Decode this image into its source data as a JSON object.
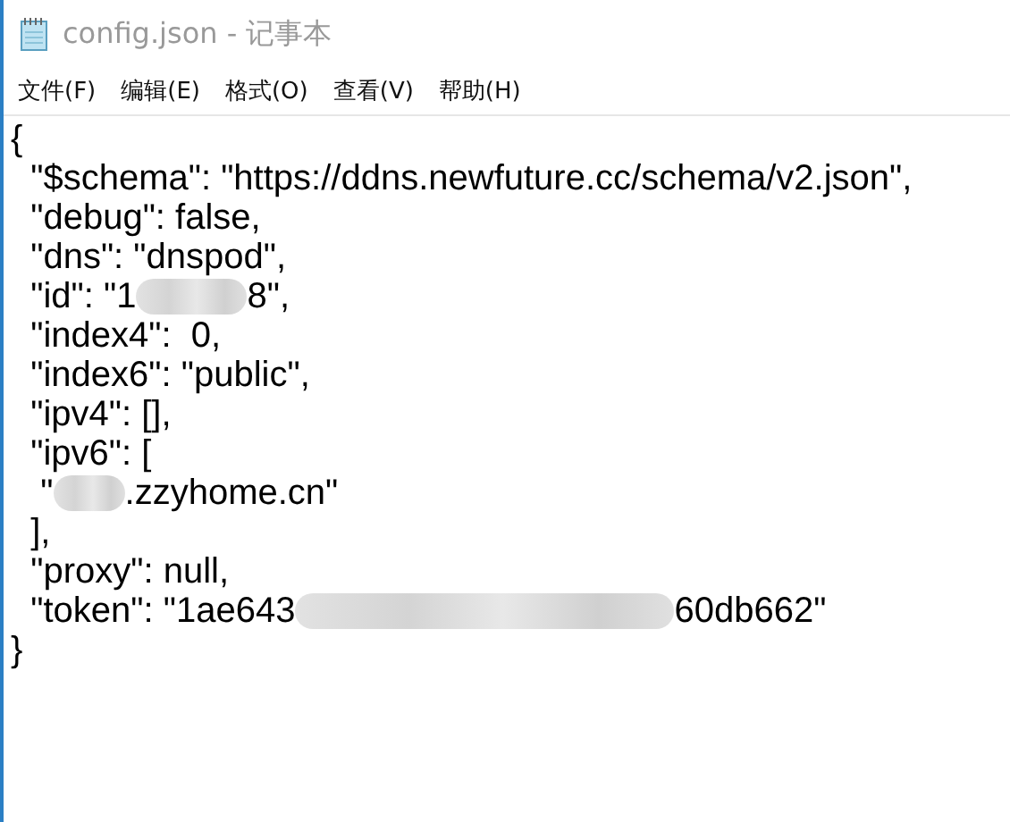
{
  "window": {
    "title": "config.json - 记事本"
  },
  "menu": [
    {
      "label": "文件(F)"
    },
    {
      "label": "编辑(E)"
    },
    {
      "label": "格式(O)"
    },
    {
      "label": "查看(V)"
    },
    {
      "label": "帮助(H)"
    }
  ],
  "lines": [
    [
      {
        "kind": "text",
        "text": "{"
      }
    ],
    [
      {
        "kind": "text",
        "text": "  \"$schema\": \"https://ddns.newfuture.cc/schema/v2.json\","
      }
    ],
    [
      {
        "kind": "text",
        "text": "  \"debug\": false,"
      }
    ],
    [
      {
        "kind": "text",
        "text": "  \"dns\": \"dnspod\","
      }
    ],
    [
      {
        "kind": "text",
        "text": "  \"id\": \"1"
      },
      {
        "kind": "blur_mid"
      },
      {
        "kind": "text",
        "text": "8\","
      }
    ],
    [
      {
        "kind": "text",
        "text": "  \"index4\":  0,"
      }
    ],
    [
      {
        "kind": "text",
        "text": "  \"index6\": \"public\","
      }
    ],
    [
      {
        "kind": "text",
        "text": "  \"ipv4\": [],"
      }
    ],
    [
      {
        "kind": "text",
        "text": "  \"ipv6\": ["
      }
    ],
    [
      {
        "kind": "text",
        "text": "   \""
      },
      {
        "kind": "blur_short"
      },
      {
        "kind": "text",
        "text": ".zzyhome.cn\""
      }
    ],
    [
      {
        "kind": "text",
        "text": "  ],"
      }
    ],
    [
      {
        "kind": "text",
        "text": "  \"proxy\": null,"
      }
    ],
    [
      {
        "kind": "text",
        "text": "  \"token\": \"1ae643"
      },
      {
        "kind": "blur_long"
      },
      {
        "kind": "text",
        "text": "60db662\""
      }
    ],
    [
      {
        "kind": "text",
        "text": "}"
      }
    ]
  ]
}
